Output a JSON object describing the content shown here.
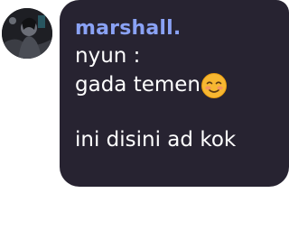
{
  "message": {
    "author": "marshall.",
    "lines": [
      "nyun  :",
      "gada temen",
      "",
      "ini disini ad kok"
    ],
    "emoji": "smiling-blush-emoji"
  },
  "colors": {
    "bubble": "#272331",
    "author": "#8aa2f5",
    "text": "#ffffff",
    "emoji": "#f7b731"
  }
}
